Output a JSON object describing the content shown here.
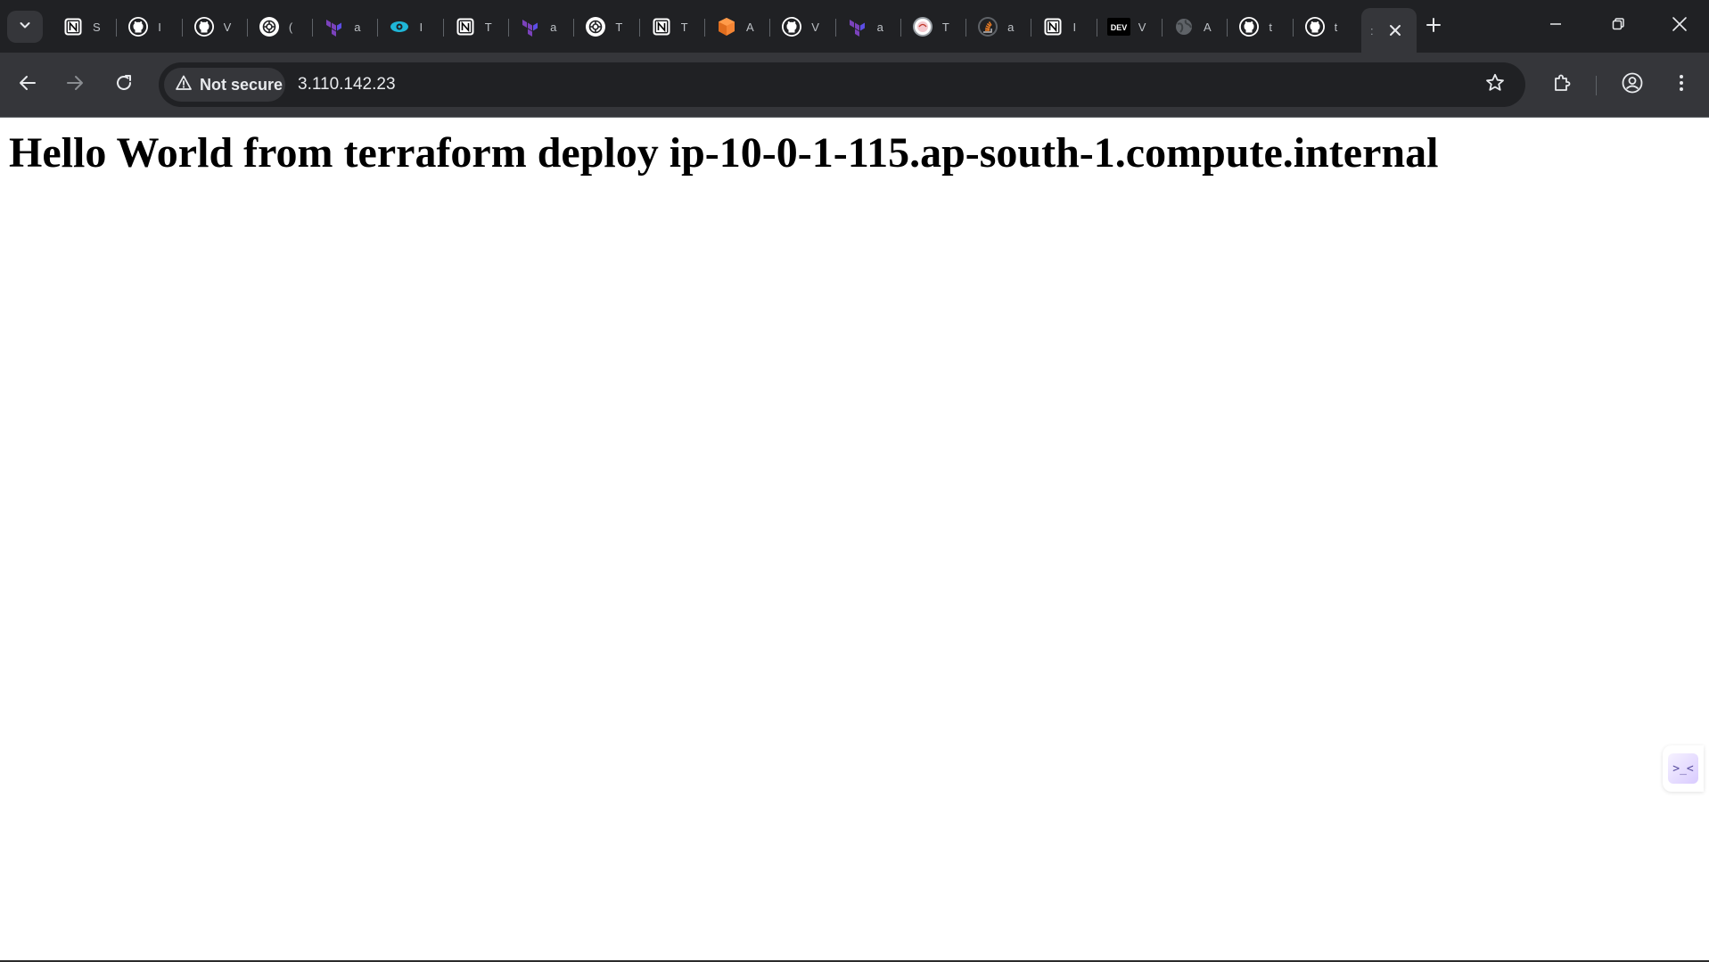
{
  "colors": {
    "tabstrip_bg": "#202124",
    "toolbar_bg": "#35363a",
    "omnibox_bg": "#202124",
    "text_light": "#e8eaed",
    "page_bg": "#ffffff"
  },
  "tabs": [
    {
      "icon": "notion-icon",
      "title": "S"
    },
    {
      "icon": "github-icon",
      "title": "I"
    },
    {
      "icon": "github-icon",
      "title": "V"
    },
    {
      "icon": "chatgpt-icon",
      "title": "("
    },
    {
      "icon": "terraform-icon",
      "title": "a"
    },
    {
      "icon": "eye-cloud-icon",
      "title": "I"
    },
    {
      "icon": "notion-icon",
      "title": "T"
    },
    {
      "icon": "terraform-icon",
      "title": "a"
    },
    {
      "icon": "chatgpt-icon",
      "title": "T"
    },
    {
      "icon": "notion-icon",
      "title": "T"
    },
    {
      "icon": "aws-cube-icon",
      "title": "A"
    },
    {
      "icon": "github-icon",
      "title": "V"
    },
    {
      "icon": "terraform-icon",
      "title": "a"
    },
    {
      "icon": "circle-badge-icon",
      "title": "T"
    },
    {
      "icon": "stackoverflow-icon",
      "title": "a"
    },
    {
      "icon": "notion-icon",
      "title": "I"
    },
    {
      "icon": "dev-icon",
      "title": "V"
    },
    {
      "icon": "globe-icon",
      "title": "A"
    },
    {
      "icon": "github-icon",
      "title": "t"
    },
    {
      "icon": "github-icon",
      "title": "t"
    }
  ],
  "active_tab": {
    "title": ":"
  },
  "address_bar": {
    "security_label": "Not secure",
    "url": "3.110.142.23"
  },
  "page": {
    "heading": "Hello World from terraform deploy ip-10-0-1-115.ap-south-1.compute.internal"
  },
  "side_widget": {
    "label": ">_<"
  }
}
